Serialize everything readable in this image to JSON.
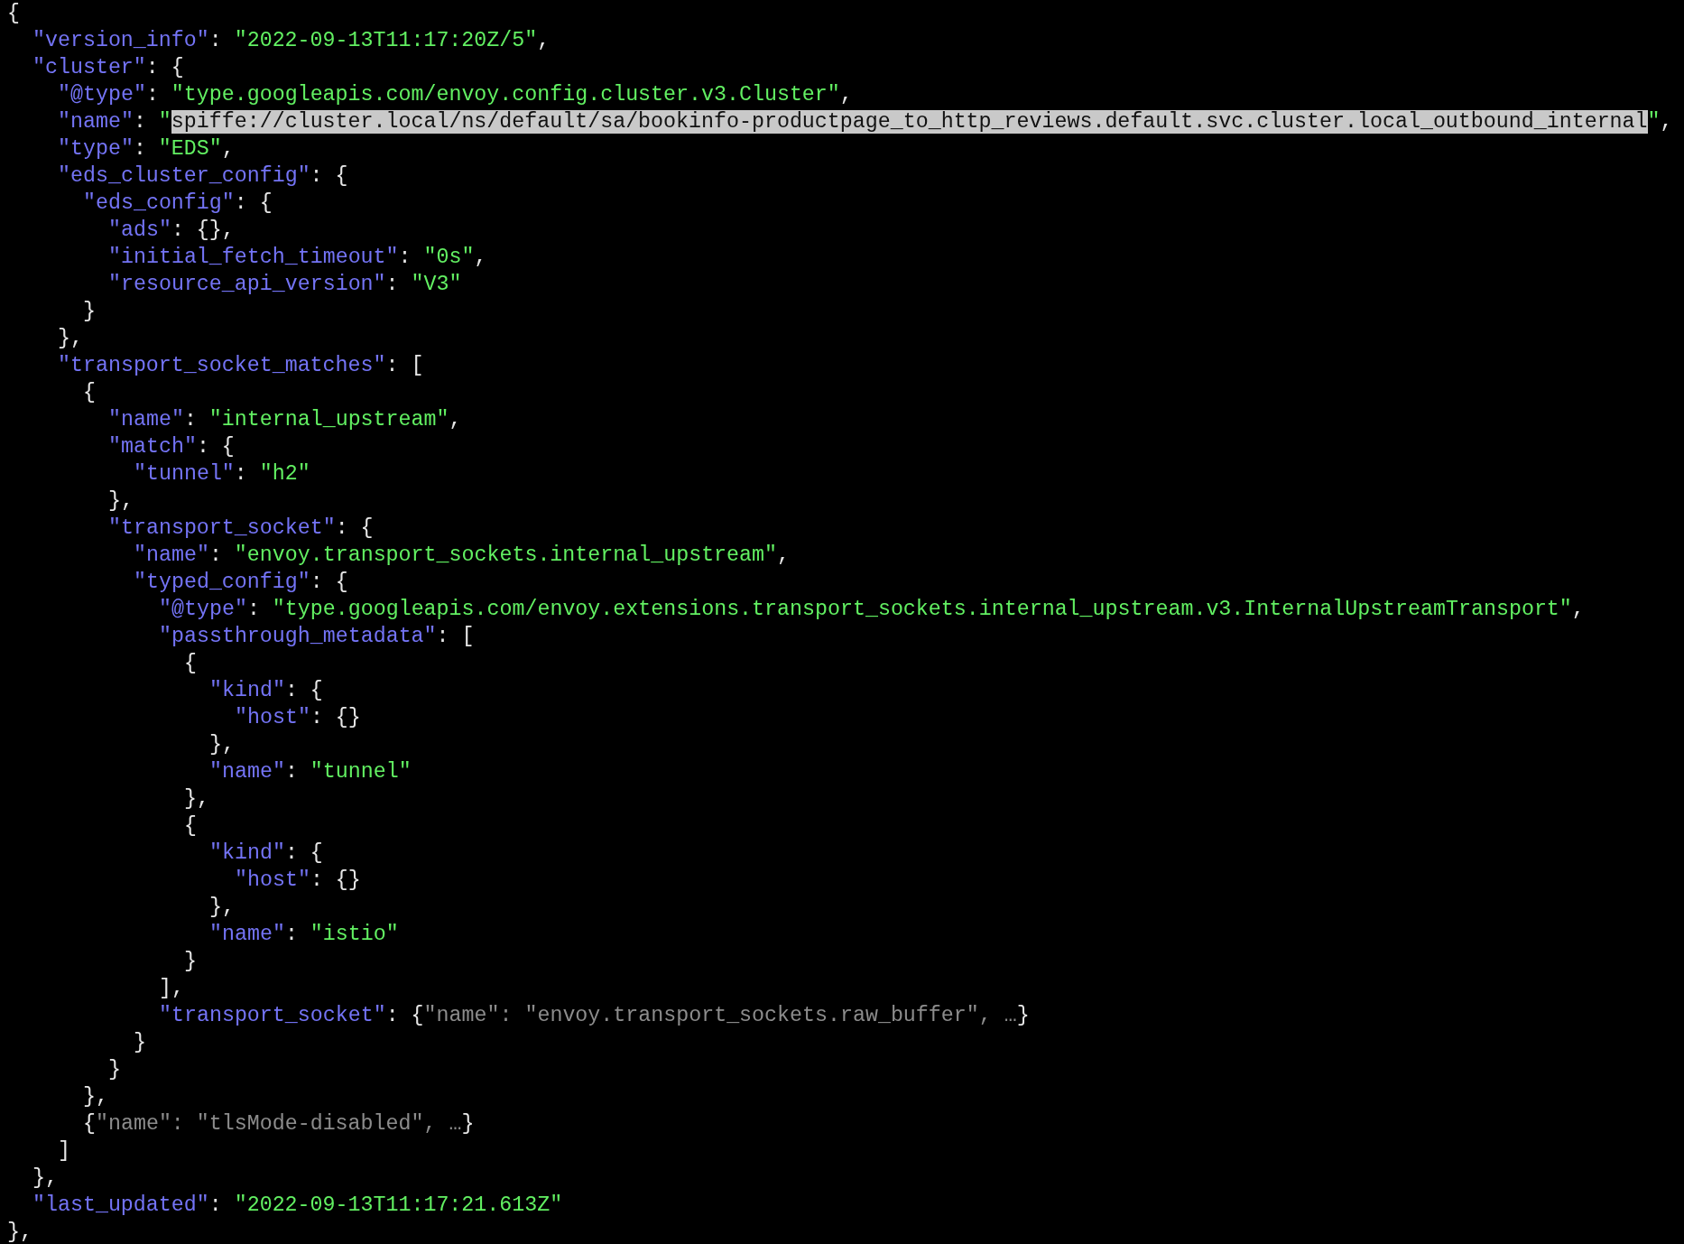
{
  "lines": [
    {
      "tokens": [
        {
          "kind": "punct",
          "text": "{"
        }
      ],
      "children": [
        {
          "tokens": [
            {
              "kind": "key",
              "text": "\"version_info\""
            },
            {
              "kind": "punct",
              "text": ": "
            },
            {
              "kind": "str",
              "text": "\"2022-09-13T11:17:20Z/5\""
            },
            {
              "kind": "punct",
              "text": ","
            }
          ]
        },
        {
          "tokens": [
            {
              "kind": "key",
              "text": "\"cluster\""
            },
            {
              "kind": "punct",
              "text": ": {"
            }
          ],
          "children": [
            {
              "tokens": [
                {
                  "kind": "key",
                  "text": "\"@type\""
                },
                {
                  "kind": "punct",
                  "text": ": "
                },
                {
                  "kind": "str",
                  "text": "\"type.googleapis.com/envoy.config.cluster.v3.Cluster\""
                },
                {
                  "kind": "punct",
                  "text": ","
                }
              ]
            },
            {
              "tokens": [
                {
                  "kind": "key",
                  "text": "\"name\""
                },
                {
                  "kind": "punct",
                  "text": ": "
                },
                {
                  "kind": "str",
                  "text": "\""
                },
                {
                  "kind": "sel",
                  "text": "spiffe://cluster.local/ns/default/sa/bookinfo-productpage_to_http_reviews.default.svc.cluster.local_outbound_internal"
                },
                {
                  "kind": "str",
                  "text": "\""
                },
                {
                  "kind": "punct",
                  "text": ","
                }
              ]
            },
            {
              "tokens": [
                {
                  "kind": "key",
                  "text": "\"type\""
                },
                {
                  "kind": "punct",
                  "text": ": "
                },
                {
                  "kind": "str",
                  "text": "\"EDS\""
                },
                {
                  "kind": "punct",
                  "text": ","
                }
              ]
            },
            {
              "tokens": [
                {
                  "kind": "key",
                  "text": "\"eds_cluster_config\""
                },
                {
                  "kind": "punct",
                  "text": ": {"
                }
              ],
              "children": [
                {
                  "tokens": [
                    {
                      "kind": "key",
                      "text": "\"eds_config\""
                    },
                    {
                      "kind": "punct",
                      "text": ": {"
                    }
                  ],
                  "children": [
                    {
                      "tokens": [
                        {
                          "kind": "key",
                          "text": "\"ads\""
                        },
                        {
                          "kind": "punct",
                          "text": ": {},"
                        }
                      ]
                    },
                    {
                      "tokens": [
                        {
                          "kind": "key",
                          "text": "\"initial_fetch_timeout\""
                        },
                        {
                          "kind": "punct",
                          "text": ": "
                        },
                        {
                          "kind": "str",
                          "text": "\"0s\""
                        },
                        {
                          "kind": "punct",
                          "text": ","
                        }
                      ]
                    },
                    {
                      "tokens": [
                        {
                          "kind": "key",
                          "text": "\"resource_api_version\""
                        },
                        {
                          "kind": "punct",
                          "text": ": "
                        },
                        {
                          "kind": "str",
                          "text": "\"V3\""
                        }
                      ]
                    }
                  ]
                },
                {
                  "tokens": [
                    {
                      "kind": "punct",
                      "text": "}"
                    }
                  ]
                }
              ]
            },
            {
              "tokens": [
                {
                  "kind": "punct",
                  "text": "},"
                }
              ]
            },
            {
              "tokens": [
                {
                  "kind": "key",
                  "text": "\"transport_socket_matches\""
                },
                {
                  "kind": "punct",
                  "text": ": ["
                }
              ],
              "children": [
                {
                  "tokens": [
                    {
                      "kind": "punct",
                      "text": "{"
                    }
                  ],
                  "children": [
                    {
                      "tokens": [
                        {
                          "kind": "key",
                          "text": "\"name\""
                        },
                        {
                          "kind": "punct",
                          "text": ": "
                        },
                        {
                          "kind": "str",
                          "text": "\"internal_upstream\""
                        },
                        {
                          "kind": "punct",
                          "text": ","
                        }
                      ]
                    },
                    {
                      "tokens": [
                        {
                          "kind": "key",
                          "text": "\"match\""
                        },
                        {
                          "kind": "punct",
                          "text": ": {"
                        }
                      ],
                      "children": [
                        {
                          "tokens": [
                            {
                              "kind": "key",
                              "text": "\"tunnel\""
                            },
                            {
                              "kind": "punct",
                              "text": ": "
                            },
                            {
                              "kind": "str",
                              "text": "\"h2\""
                            }
                          ]
                        }
                      ]
                    },
                    {
                      "tokens": [
                        {
                          "kind": "punct",
                          "text": "},"
                        }
                      ]
                    },
                    {
                      "tokens": [
                        {
                          "kind": "key",
                          "text": "\"transport_socket\""
                        },
                        {
                          "kind": "punct",
                          "text": ": {"
                        }
                      ],
                      "children": [
                        {
                          "tokens": [
                            {
                              "kind": "key",
                              "text": "\"name\""
                            },
                            {
                              "kind": "punct",
                              "text": ": "
                            },
                            {
                              "kind": "str",
                              "text": "\"envoy.transport_sockets.internal_upstream\""
                            },
                            {
                              "kind": "punct",
                              "text": ","
                            }
                          ]
                        },
                        {
                          "tokens": [
                            {
                              "kind": "key",
                              "text": "\"typed_config\""
                            },
                            {
                              "kind": "punct",
                              "text": ": {"
                            }
                          ],
                          "children": [
                            {
                              "tokens": [
                                {
                                  "kind": "key",
                                  "text": "\"@type\""
                                },
                                {
                                  "kind": "punct",
                                  "text": ": "
                                },
                                {
                                  "kind": "str",
                                  "text": "\"type.googleapis.com/envoy.extensions.transport_sockets.internal_upstream.v3.InternalUpstreamTransport\""
                                },
                                {
                                  "kind": "punct",
                                  "text": ","
                                }
                              ]
                            },
                            {
                              "tokens": [
                                {
                                  "kind": "key",
                                  "text": "\"passthrough_metadata\""
                                },
                                {
                                  "kind": "punct",
                                  "text": ": ["
                                }
                              ],
                              "children": [
                                {
                                  "tokens": [
                                    {
                                      "kind": "punct",
                                      "text": "{"
                                    }
                                  ],
                                  "children": [
                                    {
                                      "tokens": [
                                        {
                                          "kind": "key",
                                          "text": "\"kind\""
                                        },
                                        {
                                          "kind": "punct",
                                          "text": ": {"
                                        }
                                      ],
                                      "children": [
                                        {
                                          "tokens": [
                                            {
                                              "kind": "key",
                                              "text": "\"host\""
                                            },
                                            {
                                              "kind": "punct",
                                              "text": ": {}"
                                            }
                                          ]
                                        }
                                      ]
                                    },
                                    {
                                      "tokens": [
                                        {
                                          "kind": "punct",
                                          "text": "},"
                                        }
                                      ]
                                    },
                                    {
                                      "tokens": [
                                        {
                                          "kind": "key",
                                          "text": "\"name\""
                                        },
                                        {
                                          "kind": "punct",
                                          "text": ": "
                                        },
                                        {
                                          "kind": "str",
                                          "text": "\"tunnel\""
                                        }
                                      ]
                                    }
                                  ]
                                },
                                {
                                  "tokens": [
                                    {
                                      "kind": "punct",
                                      "text": "},"
                                    }
                                  ]
                                },
                                {
                                  "tokens": [
                                    {
                                      "kind": "punct",
                                      "text": "{"
                                    }
                                  ],
                                  "children": [
                                    {
                                      "tokens": [
                                        {
                                          "kind": "key",
                                          "text": "\"kind\""
                                        },
                                        {
                                          "kind": "punct",
                                          "text": ": {"
                                        }
                                      ],
                                      "children": [
                                        {
                                          "tokens": [
                                            {
                                              "kind": "key",
                                              "text": "\"host\""
                                            },
                                            {
                                              "kind": "punct",
                                              "text": ": {}"
                                            }
                                          ]
                                        }
                                      ]
                                    },
                                    {
                                      "tokens": [
                                        {
                                          "kind": "punct",
                                          "text": "},"
                                        }
                                      ]
                                    },
                                    {
                                      "tokens": [
                                        {
                                          "kind": "key",
                                          "text": "\"name\""
                                        },
                                        {
                                          "kind": "punct",
                                          "text": ": "
                                        },
                                        {
                                          "kind": "str",
                                          "text": "\"istio\""
                                        }
                                      ]
                                    }
                                  ]
                                },
                                {
                                  "tokens": [
                                    {
                                      "kind": "punct",
                                      "text": "}"
                                    }
                                  ]
                                }
                              ]
                            },
                            {
                              "tokens": [
                                {
                                  "kind": "punct",
                                  "text": "],"
                                }
                              ]
                            },
                            {
                              "tokens": [
                                {
                                  "kind": "key",
                                  "text": "\"transport_socket\""
                                },
                                {
                                  "kind": "punct",
                                  "text": ": {"
                                },
                                {
                                  "kind": "dim",
                                  "text": "\"name\": \"envoy.transport_sockets.raw_buffer\", …"
                                },
                                {
                                  "kind": "punct",
                                  "text": "}"
                                }
                              ]
                            }
                          ]
                        },
                        {
                          "tokens": [
                            {
                              "kind": "punct",
                              "text": "}"
                            }
                          ]
                        }
                      ]
                    },
                    {
                      "tokens": [
                        {
                          "kind": "punct",
                          "text": "}"
                        }
                      ]
                    }
                  ]
                },
                {
                  "tokens": [
                    {
                      "kind": "punct",
                      "text": "},"
                    }
                  ]
                },
                {
                  "tokens": [
                    {
                      "kind": "punct",
                      "text": "{"
                    },
                    {
                      "kind": "dim",
                      "text": "\"name\": \"tlsMode-disabled\", …"
                    },
                    {
                      "kind": "punct",
                      "text": "}"
                    }
                  ]
                }
              ]
            },
            {
              "tokens": [
                {
                  "kind": "punct",
                  "text": "]"
                }
              ]
            }
          ]
        },
        {
          "tokens": [
            {
              "kind": "punct",
              "text": "},"
            }
          ]
        },
        {
          "tokens": [
            {
              "kind": "key",
              "text": "\"last_updated\""
            },
            {
              "kind": "punct",
              "text": ": "
            },
            {
              "kind": "str",
              "text": "\"2022-09-13T11:17:21.613Z\""
            }
          ]
        }
      ]
    },
    {
      "tokens": [
        {
          "kind": "punct",
          "text": "},"
        }
      ]
    }
  ]
}
